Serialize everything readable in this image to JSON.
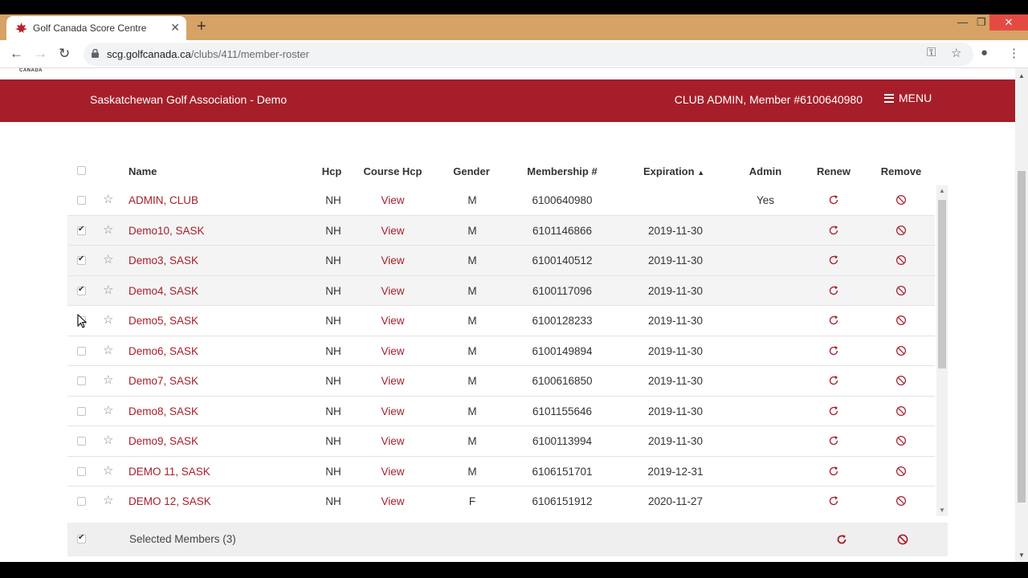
{
  "browser": {
    "tab_title": "Golf Canada Score Centre",
    "url_host": "scg.golfcanada.ca",
    "url_path": "/clubs/411/member-roster"
  },
  "header": {
    "logo_fragment": "CANADA",
    "club_name": "Saskatchewan Golf Association - Demo",
    "member_info": "CLUB ADMIN, Member #6100640980",
    "menu_label": "MENU",
    "background_color": "#a61e2a"
  },
  "table": {
    "columns": {
      "name": "Name",
      "hcp": "Hcp",
      "course_hcp": "Course Hcp",
      "gender": "Gender",
      "membership": "Membership #",
      "expiration": "Expiration",
      "admin": "Admin",
      "renew": "Renew",
      "remove": "Remove"
    },
    "sort_column": "expiration",
    "sort_direction": "ascending",
    "rows": [
      {
        "name": "ADMIN, CLUB",
        "hcp": "NH",
        "course_hcp": "View",
        "gender": "M",
        "membership": "6100640980",
        "expiration": "",
        "admin": "Yes",
        "checked": false
      },
      {
        "name": "Demo10, SASK",
        "hcp": "NH",
        "course_hcp": "View",
        "gender": "M",
        "membership": "6101146866",
        "expiration": "2019-11-30",
        "admin": "",
        "checked": true
      },
      {
        "name": "Demo3, SASK",
        "hcp": "NH",
        "course_hcp": "View",
        "gender": "M",
        "membership": "6100140512",
        "expiration": "2019-11-30",
        "admin": "",
        "checked": true
      },
      {
        "name": "Demo4, SASK",
        "hcp": "NH",
        "course_hcp": "View",
        "gender": "M",
        "membership": "6100117096",
        "expiration": "2019-11-30",
        "admin": "",
        "checked": true
      },
      {
        "name": "Demo5, SASK",
        "hcp": "NH",
        "course_hcp": "View",
        "gender": "M",
        "membership": "6100128233",
        "expiration": "2019-11-30",
        "admin": "",
        "checked": false
      },
      {
        "name": "Demo6, SASK",
        "hcp": "NH",
        "course_hcp": "View",
        "gender": "M",
        "membership": "6100149894",
        "expiration": "2019-11-30",
        "admin": "",
        "checked": false
      },
      {
        "name": "Demo7, SASK",
        "hcp": "NH",
        "course_hcp": "View",
        "gender": "M",
        "membership": "6100616850",
        "expiration": "2019-11-30",
        "admin": "",
        "checked": false
      },
      {
        "name": "Demo8, SASK",
        "hcp": "NH",
        "course_hcp": "View",
        "gender": "M",
        "membership": "6101155646",
        "expiration": "2019-11-30",
        "admin": "",
        "checked": false
      },
      {
        "name": "Demo9, SASK",
        "hcp": "NH",
        "course_hcp": "View",
        "gender": "M",
        "membership": "6100113994",
        "expiration": "2019-11-30",
        "admin": "",
        "checked": false
      },
      {
        "name": "DEMO 11, SASK",
        "hcp": "NH",
        "course_hcp": "View",
        "gender": "M",
        "membership": "6106151701",
        "expiration": "2019-12-31",
        "admin": "",
        "checked": false
      },
      {
        "name": "DEMO 12, SASK",
        "hcp": "NH",
        "course_hcp": "View",
        "gender": "F",
        "membership": "6106151912",
        "expiration": "2020-11-27",
        "admin": "",
        "checked": false
      }
    ],
    "footer": {
      "selected_label": "Selected Members (3)",
      "checked": true
    }
  },
  "icons": {
    "row_star": "star-outline-icon",
    "renew": "refresh-icon",
    "remove": "ban-icon"
  },
  "colors": {
    "accent": "#a61e2a",
    "tab_bar": "#d6a265",
    "link": "#a61e2a"
  }
}
